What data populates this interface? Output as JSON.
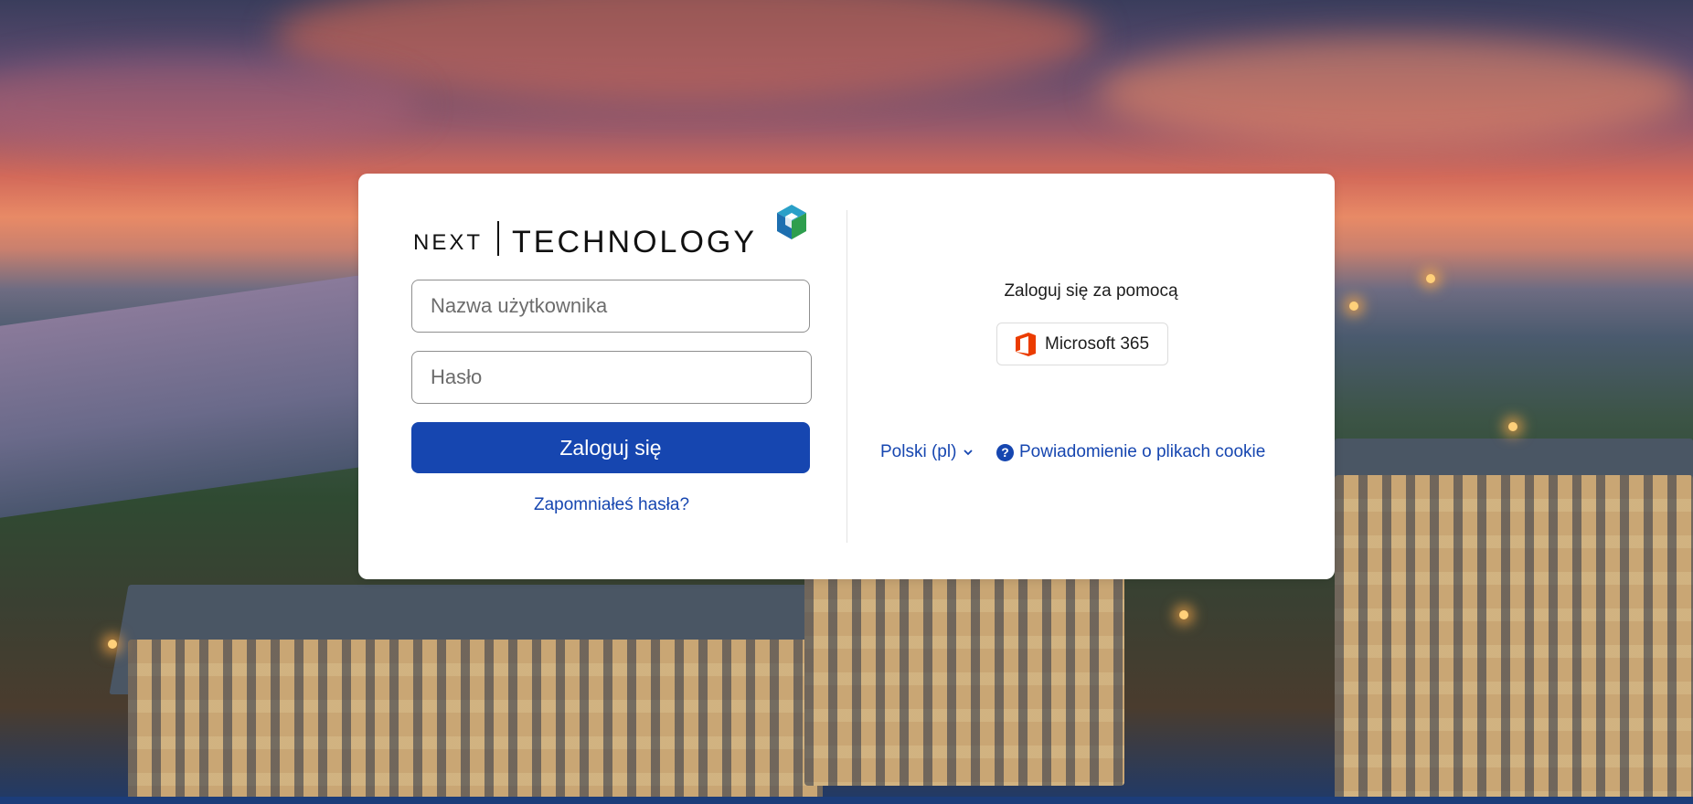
{
  "logo": {
    "brand_left": "NEXT",
    "brand_right": "TECHNOLOGY",
    "icon": "cube-logo-icon"
  },
  "login_form": {
    "username_placeholder": "Nazwa użytkownika",
    "password_placeholder": "Hasło",
    "submit_label": "Zaloguj się",
    "forgot_link": "Zapomniałeś hasła?"
  },
  "sso": {
    "heading": "Zaloguj się za pomocą",
    "provider_label": "Microsoft 365",
    "provider_icon": "office-icon"
  },
  "footer": {
    "language_label": "Polski (pl)",
    "language_icon": "chevron-down-icon",
    "cookie_label": "Powiadomienie o plikach cookie",
    "cookie_icon": "question-circle-icon"
  },
  "colors": {
    "primary": "#1646b0",
    "card_bg": "#ffffff",
    "office_orange": "#eb3c00"
  }
}
